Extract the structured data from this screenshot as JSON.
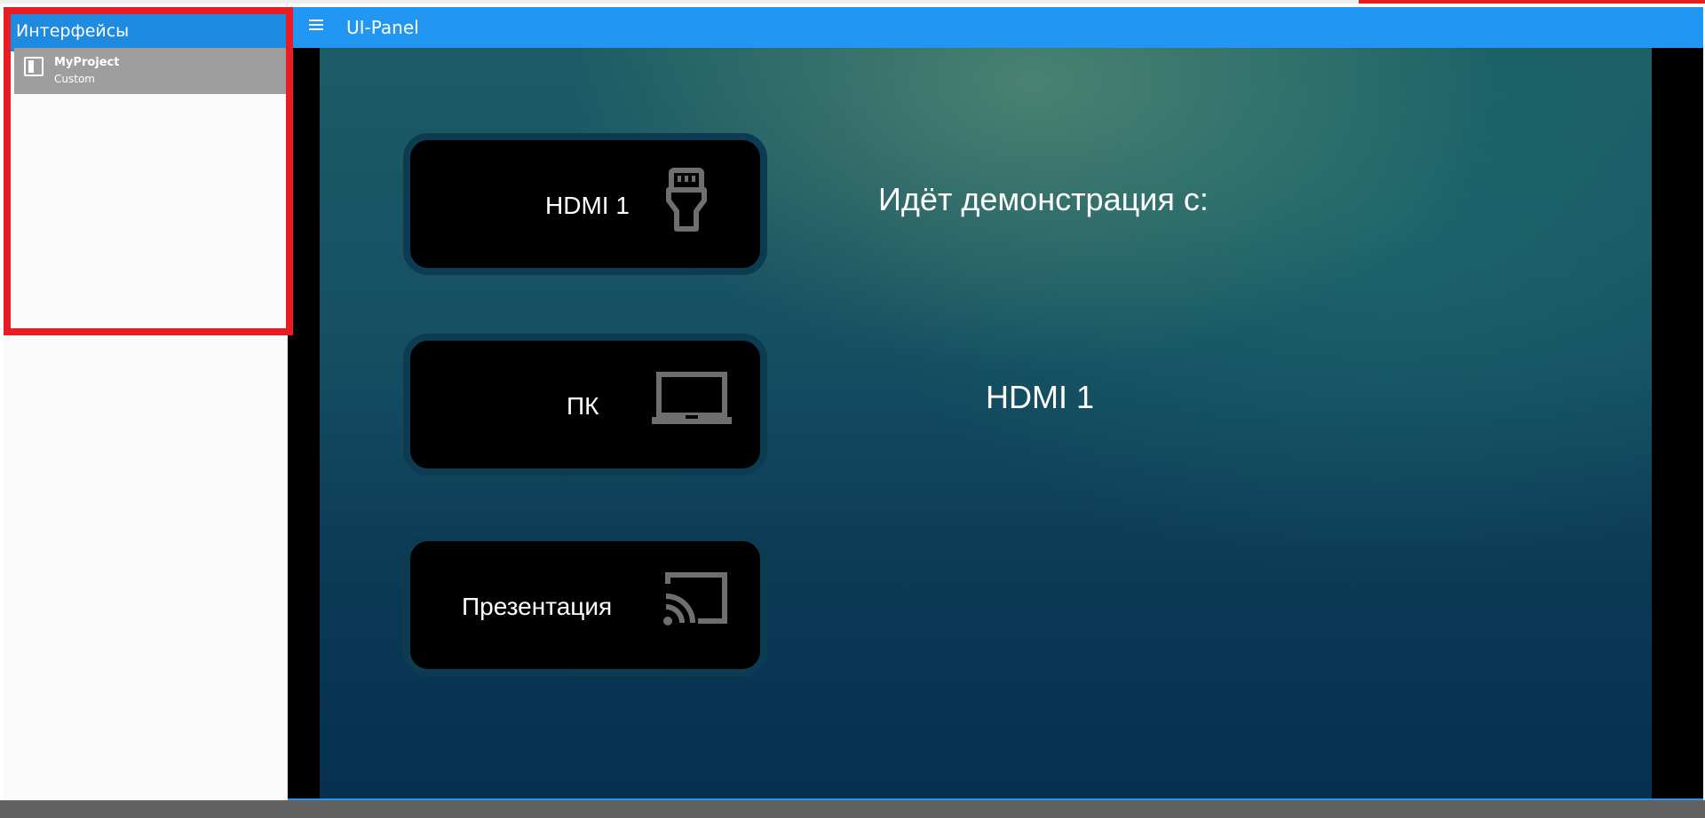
{
  "sidebar": {
    "header": "Интерфейсы",
    "items": [
      {
        "title": "MyProject",
        "subtitle": "Custom",
        "icon": "panel-icon"
      }
    ]
  },
  "appbar": {
    "title": "UI-Panel",
    "menu_icon": "hamburger-menu-icon"
  },
  "panel": {
    "buttons": [
      {
        "label": "HDMI 1",
        "icon": "hdmi-connector-icon"
      },
      {
        "label": "ПК",
        "icon": "laptop-icon"
      },
      {
        "label": "Презентация",
        "icon": "cast-icon"
      }
    ],
    "status_title": "Идёт демонстрация с:",
    "status_value": "HDMI 1"
  },
  "colors": {
    "appbar": "#2196f3",
    "sidebar_header": "#1f8be0",
    "sidebar_item_selected": "#9e9e9e",
    "highlight": "#e81c24",
    "button_bg": "#000000",
    "icon_gray": "#6f6f6f"
  }
}
